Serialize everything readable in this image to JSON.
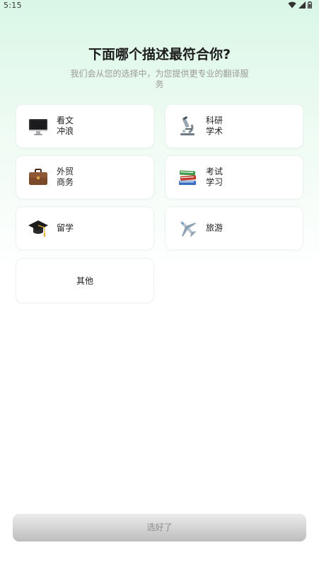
{
  "status_bar": {
    "time": "5:15"
  },
  "question": {
    "title": "下面哪个描述最符合你?",
    "subtitle": "我们会从您的选择中，为您提供更专业的翻译服务"
  },
  "options": [
    {
      "icon": "computer-icon",
      "lines": [
        "看文",
        "冲浪"
      ]
    },
    {
      "icon": "microscope-icon",
      "lines": [
        "科研",
        "学术"
      ]
    },
    {
      "icon": "briefcase-icon",
      "lines": [
        "外贸",
        "商务"
      ]
    },
    {
      "icon": "books-icon",
      "lines": [
        "考试",
        "学习"
      ]
    },
    {
      "icon": "graduation-cap-icon",
      "lines": [
        "留学"
      ]
    },
    {
      "icon": "airplane-icon",
      "lines": [
        "旅游"
      ]
    },
    {
      "icon": "",
      "lines": [
        "其他"
      ]
    }
  ],
  "confirm_button": {
    "label": "选好了",
    "enabled": false
  },
  "colors": {
    "background_top": "#d9f7e6",
    "card_background": "#ffffff",
    "button_disabled": "#c9c9c9"
  }
}
